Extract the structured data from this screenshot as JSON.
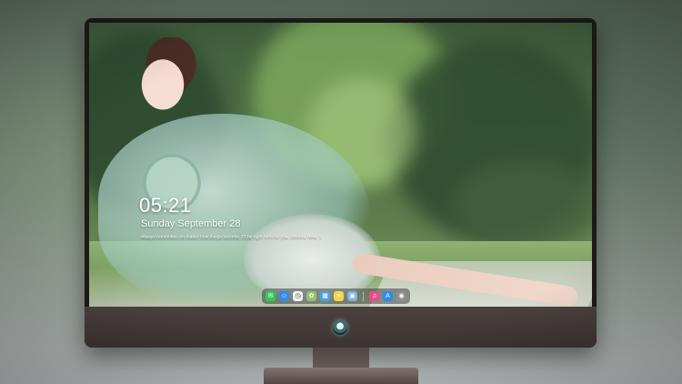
{
  "lock_screen": {
    "time": "05:21",
    "date": "Sunday September 28",
    "quote": "Always remember, no matter how things become, I'll be right here for you. (Minoru Hina ·)"
  },
  "dock": {
    "apps": [
      {
        "name": "messages-icon",
        "glyph": "✉",
        "color": "#34c759"
      },
      {
        "name": "finder-icon",
        "glyph": "☺",
        "color": "#2f8cf0"
      },
      {
        "name": "clock-icon",
        "glyph": "◷",
        "color": "#f2f2f2"
      },
      {
        "name": "photos-icon",
        "glyph": "✿",
        "color": "#8fc46a"
      },
      {
        "name": "launchpad-icon",
        "glyph": "▦",
        "color": "#4aa3df"
      },
      {
        "name": "notes-icon",
        "glyph": "≡",
        "color": "#f5d547"
      },
      {
        "name": "preview-icon",
        "glyph": "▣",
        "color": "#7cb3e0"
      },
      {
        "name": "itunes-icon",
        "glyph": "♫",
        "color": "#ea4c89"
      },
      {
        "name": "app-store-icon",
        "glyph": "A",
        "color": "#2d8cf0"
      },
      {
        "name": "camera-icon",
        "glyph": "◉",
        "color": "#8e8e93"
      }
    ]
  }
}
